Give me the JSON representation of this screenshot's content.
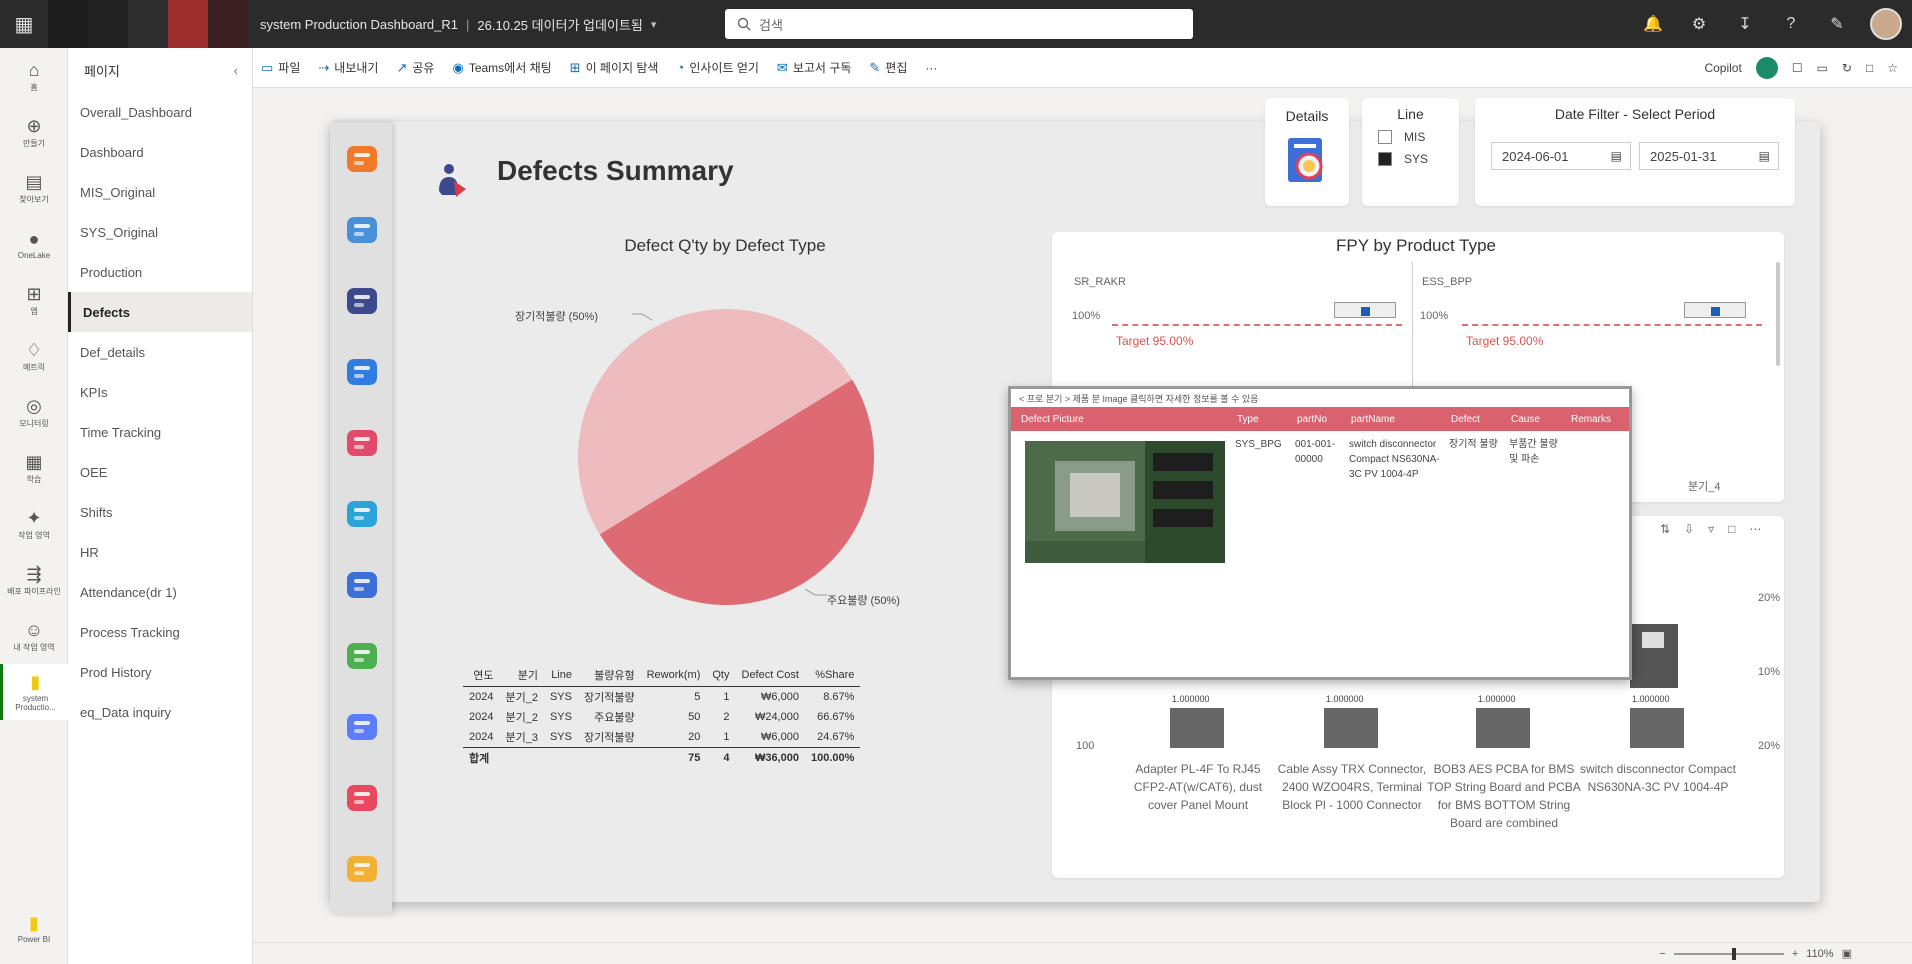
{
  "topbar": {
    "breadcrumb_title": "system Production Dashboard_R1",
    "breadcrumb_meta": "26.10.25 데이터가 업데이트됨",
    "search_placeholder": "검색"
  },
  "rail": [
    {
      "label": "홈",
      "icon": "home-icon"
    },
    {
      "label": "만들기",
      "icon": "create-icon"
    },
    {
      "label": "찾아보기",
      "icon": "browse-icon"
    },
    {
      "label": "OneLake",
      "icon": "onelake-icon"
    },
    {
      "label": "앱",
      "icon": "apps-icon"
    },
    {
      "label": "메트릭",
      "icon": "metrics-icon"
    },
    {
      "label": "모니터링",
      "icon": "monitor-icon"
    },
    {
      "label": "학습",
      "icon": "learn-icon"
    },
    {
      "label": "작업 영역",
      "icon": "workspaces-icon"
    },
    {
      "label": "배포 파이프라인",
      "icon": "pipeline-icon"
    },
    {
      "label": "내 작업 영역",
      "icon": "my-workspace-icon"
    },
    {
      "label": "system Productio...",
      "icon": "report-icon"
    }
  ],
  "rail_bottom_label": "Power BI",
  "pages": {
    "header": "페이지",
    "items": [
      "Overall_Dashboard",
      "Dashboard",
      "MIS_Original",
      "SYS_Original",
      "Production",
      "Defects",
      "Def_details",
      "KPIs",
      "Time Tracking",
      "OEE",
      "Shifts",
      "HR",
      "Attendance(dr 1)",
      "Process Tracking",
      "Prod History",
      "eq_Data inquiry"
    ],
    "active": "Defects"
  },
  "toolbar": {
    "items": [
      {
        "label": "파일",
        "icon": "file-icon"
      },
      {
        "label": "내보내기",
        "icon": "export-icon"
      },
      {
        "label": "공유",
        "icon": "share-icon"
      },
      {
        "label": "Teams에서 채팅",
        "icon": "teams-icon"
      },
      {
        "label": "이 페이지 탐색",
        "icon": "explore-icon"
      },
      {
        "label": "인사이트 얻기",
        "icon": "insights-icon"
      },
      {
        "label": "보고서 구독",
        "icon": "subscribe-icon"
      },
      {
        "label": "편집",
        "icon": "edit-icon"
      }
    ],
    "copilot_label": "Copilot"
  },
  "report": {
    "title": "Defects Summary",
    "details_label": "Details",
    "line_filter": {
      "title": "Line",
      "options": [
        {
          "label": "MIS",
          "checked": false
        },
        {
          "label": "SYS",
          "checked": true
        }
      ]
    },
    "date_filter": {
      "title": "Date Filter - Select Period",
      "start": "2024-06-01",
      "end": "2025-01-31"
    }
  },
  "chart_data": [
    {
      "type": "pie",
      "title": "Defect Q'ty by Defect Type",
      "slices": [
        {
          "label": "장기적불량 (50%)",
          "value": 50,
          "color": "#eebbbf"
        },
        {
          "label": "주요불량 (50%)",
          "value": 50,
          "color": "#de6b73"
        }
      ]
    },
    {
      "type": "table",
      "columns": [
        "연도",
        "분기",
        "Line",
        "불량유형",
        "Rework(m)",
        "Qty",
        "Defect Cost",
        "%Share"
      ],
      "rows": [
        [
          "2024",
          "분기_2",
          "SYS",
          "장기적불량",
          "5",
          "1",
          "₩6,000",
          "8.67%"
        ],
        [
          "2024",
          "분기_2",
          "SYS",
          "주요불량",
          "50",
          "2",
          "₩24,000",
          "66.67%"
        ],
        [
          "2024",
          "분기_3",
          "SYS",
          "장기적불량",
          "20",
          "1",
          "₩6,000",
          "24.67%"
        ]
      ],
      "total": [
        "합계",
        "",
        "",
        "",
        "75",
        "4",
        "₩36,000",
        "100.00%"
      ]
    }
  ],
  "fpy": {
    "title": "FPY by Product Type",
    "panels": [
      {
        "name": "SR_RAKR",
        "y_top": "100%",
        "target": "Target 95.00%"
      },
      {
        "name": "ESS_BPP",
        "y_top": "100%",
        "target": "Target 95.00%"
      }
    ],
    "panel_cut_label": "분기_4"
  },
  "tooltip": {
    "header": "< 프로 분기 > 제품 분 Image 클릭하면 자세한 정보를 볼 수 있음",
    "columns": [
      "Defect Picture",
      "Type",
      "partNo",
      "partName",
      "Defect",
      "Cause",
      "Remarks"
    ],
    "row": {
      "type": "SYS_BPG",
      "partNo": "001-001-00000",
      "partName": "switch disconnector Compact NS630NA-3C PV 1004-4P",
      "defect": "장기적 불량",
      "cause": "부품간 불량 및 파손"
    }
  },
  "products": {
    "values": [
      "1.000000",
      "1.000000",
      "1.000000",
      "1.000000"
    ],
    "names": [
      "Adapter PL-4F To RJ45 CFP2-AT(w/CAT6), dust cover Panel Mount",
      "Cable Assy TRX Connector, 2400 WZO04RS, Terminal Block Pl - 1000 Connector",
      "BOB3 AES PCBA for BMS TOP String Board and PCBA for BMS BOTTOM String Board are combined",
      "switch disconnector Compact NS630NA-3C PV 1004-4P"
    ],
    "y_value": "100",
    "right_ticks": [
      "20%",
      "10%",
      "20%"
    ]
  },
  "zoom": {
    "percent": "110%"
  }
}
